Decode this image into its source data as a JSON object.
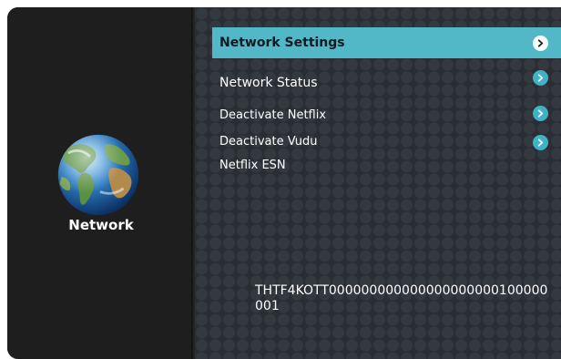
{
  "sidebar": {
    "category_label": "Network",
    "icon": "globe-icon"
  },
  "menu": {
    "items": [
      {
        "label": "Network Settings",
        "selected": true,
        "icon": "chevron-right-icon"
      },
      {
        "label": "Network Status",
        "selected": false,
        "icon": "chevron-right-icon"
      },
      {
        "label": "Deactivate Netflix",
        "selected": false,
        "icon": "chevron-right-icon"
      },
      {
        "label": "Deactivate Vudu",
        "selected": false,
        "icon": "chevron-right-icon"
      },
      {
        "label": "Netflix ESN",
        "selected": false
      }
    ],
    "esn_value": "THTF4KOTT000000000000000000000100000001"
  },
  "colors": {
    "highlight": "#52b8c7",
    "chevron_accent": "#3fb2c6",
    "panel_background": "#2a2d33",
    "sidebar_background": "#1e1e1e"
  }
}
